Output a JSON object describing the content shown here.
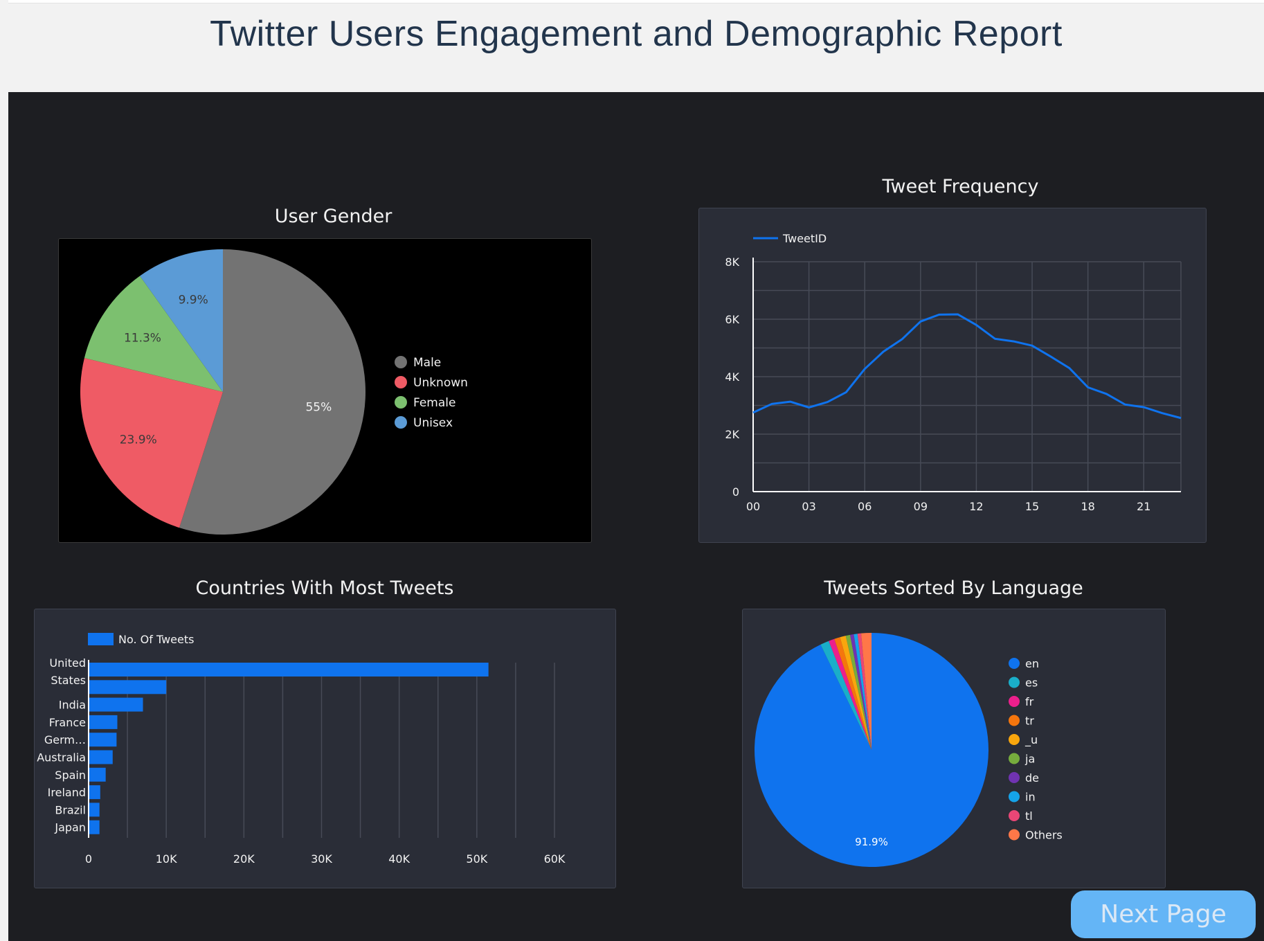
{
  "header": {
    "title": "Twitter Users Engagement and Demographic Report"
  },
  "colors": {
    "male": "#737373",
    "unknown": "#ef5b65",
    "female": "#7cc06f",
    "unisex": "#5b9bd6",
    "accent": "#0f73ee",
    "button": "#64b5f6"
  },
  "gender": {
    "title": "User Gender",
    "chart_data": {
      "type": "pie",
      "labels": [
        "Male",
        "Unknown",
        "Female",
        "Unisex"
      ],
      "values": [
        55,
        23.9,
        11.3,
        9.9
      ],
      "value_labels": [
        "55%",
        "23.9%",
        "11.3%",
        "9.9%"
      ],
      "colors": [
        "#737373",
        "#ef5b65",
        "#7cc06f",
        "#5b9bd6"
      ],
      "legend": "right"
    }
  },
  "frequency": {
    "title": "Tweet Frequency",
    "chart_data": {
      "type": "line",
      "series_name": "TweetID",
      "x": [
        "00",
        "01",
        "02",
        "03",
        "04",
        "05",
        "06",
        "07",
        "08",
        "09",
        "10",
        "11",
        "12",
        "13",
        "14",
        "15",
        "16",
        "17",
        "18",
        "19",
        "20",
        "21",
        "22",
        "23"
      ],
      "values": [
        2750,
        3050,
        3130,
        2930,
        3120,
        3460,
        4270,
        4870,
        5300,
        5920,
        6160,
        6170,
        5800,
        5320,
        5230,
        5080,
        4700,
        4300,
        3630,
        3400,
        3030,
        2940,
        2730,
        2560
      ],
      "y_ticks": [
        "0",
        "2K",
        "4K",
        "6K",
        "8K"
      ],
      "x_ticks": [
        "00",
        "03",
        "06",
        "09",
        "12",
        "15",
        "18",
        "21"
      ],
      "ylim": [
        0,
        8000
      ],
      "grid": true,
      "legend": "top-left"
    }
  },
  "countries": {
    "title": "Countries With Most Tweets",
    "chart_data": {
      "type": "bar",
      "orientation": "horizontal",
      "series_name": "No. Of Tweets",
      "categories": [
        "United States",
        "",
        "India",
        "France",
        "Germ…",
        "Australia",
        "Spain",
        "Ireland",
        "Brazil",
        "Japan"
      ],
      "values": [
        51500,
        10000,
        7000,
        3700,
        3600,
        3100,
        2200,
        1500,
        1400,
        1400
      ],
      "x_ticks": [
        "0",
        "10K",
        "20K",
        "30K",
        "40K",
        "50K",
        "60K"
      ],
      "xlim": [
        0,
        60000
      ],
      "grid": true,
      "legend": "top-left"
    }
  },
  "language": {
    "title": "Tweets Sorted By Language",
    "chart_data": {
      "type": "pie",
      "labels": [
        "en",
        "es",
        "fr",
        "tr",
        "_u",
        "ja",
        "de",
        "in",
        "tl",
        "Others"
      ],
      "values": [
        91.9,
        1.2,
        0.8,
        0.8,
        0.8,
        0.6,
        0.5,
        0.5,
        0.5,
        1.4
      ],
      "value_labels": [
        "91.9%"
      ],
      "colors": [
        "#0f73ee",
        "#1aaec9",
        "#ec1f8c",
        "#f5760d",
        "#f9a60d",
        "#76ac3d",
        "#7033b2",
        "#15a3e9",
        "#e94676",
        "#ff7748"
      ],
      "legend": "right"
    }
  },
  "next_page": {
    "label": "Next Page"
  }
}
